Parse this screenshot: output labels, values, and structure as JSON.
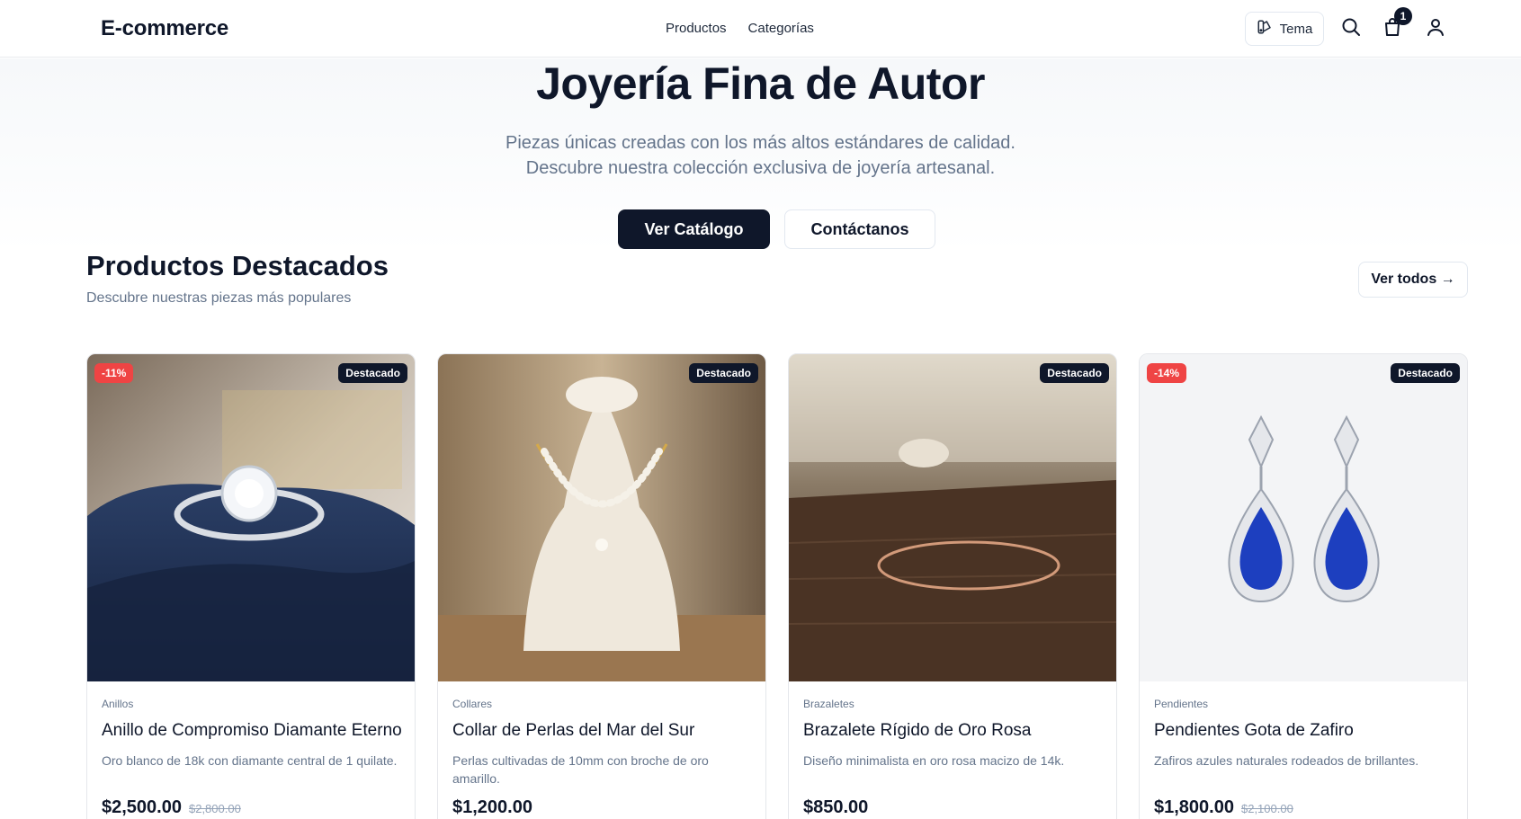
{
  "header": {
    "brand": "E-commerce",
    "nav": [
      "Productos",
      "Categorías"
    ],
    "theme_label": "Tema",
    "cart_count": "1"
  },
  "hero": {
    "title": "Joyería Fina de Autor",
    "subtitle": "Piezas únicas creadas con los más altos estándares de calidad. Descubre nuestra colección exclusiva de joyería artesanal.",
    "primary_button": "Ver Catálogo",
    "secondary_button": "Contáctanos"
  },
  "featured": {
    "title": "Productos Destacados",
    "subtitle": "Descubre nuestras piezas más populares",
    "see_all": "Ver todos →",
    "products": [
      {
        "discount": "-11%",
        "badge": "Destacado",
        "category": "Anillos",
        "name": "Anillo de Compromiso Diamante Eterno",
        "description": "Oro blanco de 18k con diamante central de 1 quilate.",
        "price": "$2,500.00",
        "old_price": "$2,800.00"
      },
      {
        "discount": "",
        "badge": "Destacado",
        "category": "Collares",
        "name": "Collar de Perlas del Mar del Sur",
        "description": "Perlas cultivadas de 10mm con broche de oro amarillo.",
        "price": "$1,200.00",
        "old_price": ""
      },
      {
        "discount": "",
        "badge": "Destacado",
        "category": "Brazaletes",
        "name": "Brazalete Rígido de Oro Rosa",
        "description": "Diseño minimalista en oro rosa macizo de 14k.",
        "price": "$850.00",
        "old_price": ""
      },
      {
        "discount": "-14%",
        "badge": "Destacado",
        "category": "Pendientes",
        "name": "Pendientes Gota de Zafiro",
        "description": "Zafiros azules naturales rodeados de brillantes.",
        "price": "$1,800.00",
        "old_price": "$2,100.00"
      }
    ]
  },
  "icons": [
    "theme-icon",
    "search-icon",
    "cart-icon",
    "user-icon"
  ],
  "colors": {
    "primary": "#0f172a",
    "discount": "#ef4444",
    "muted": "#64748b"
  }
}
